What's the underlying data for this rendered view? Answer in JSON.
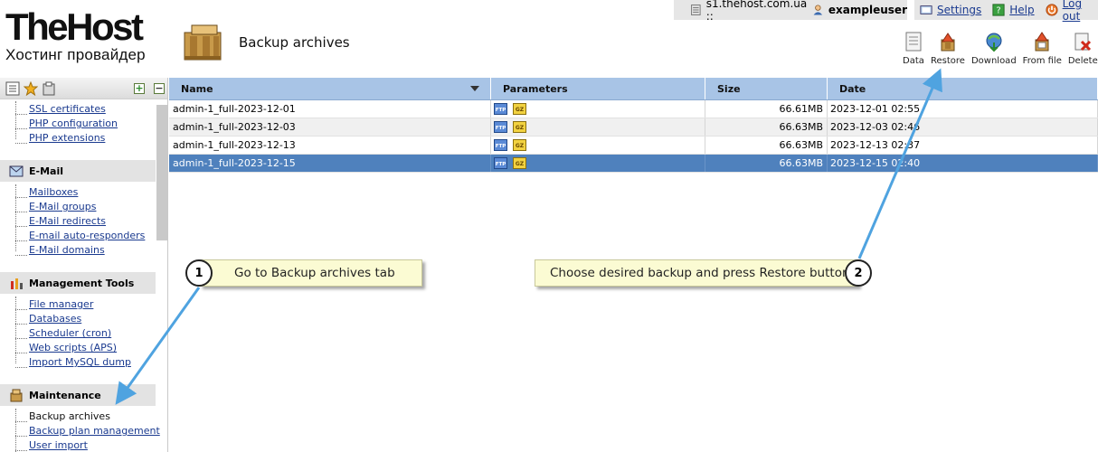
{
  "brand": {
    "name": "TheHost",
    "tagline": "Хостинг провайдер"
  },
  "page": {
    "title": "Backup archives"
  },
  "topbar": {
    "server": "s1.thehost.com.ua ::",
    "username": "exampleuser",
    "settings": "Settings",
    "help": "Help",
    "logout": "Log out"
  },
  "toolbar": [
    "Data",
    "Restore",
    "Download",
    "From file",
    "Delete"
  ],
  "sidebar": {
    "top_links": [
      "SSL certificates",
      "PHP configuration",
      "PHP extensions"
    ],
    "email": {
      "title": "E-Mail",
      "links": [
        "Mailboxes",
        "E-Mail groups",
        "E-Mail redirects",
        "E-mail auto-responders",
        "E-Mail domains"
      ]
    },
    "management": {
      "title": "Management Tools",
      "links": [
        "File manager",
        "Databases",
        "Scheduler (cron)",
        "Web scripts (APS)",
        "Import MySQL dump"
      ]
    },
    "maintenance": {
      "title": "Maintenance",
      "links": [
        "Backup archives",
        "Backup plan management",
        "User import"
      ]
    }
  },
  "table": {
    "columns": [
      "Name",
      "Parameters",
      "Size",
      "Date"
    ],
    "rows": [
      {
        "name": "admin-1_full-2023-12-01",
        "size": "66.61MB",
        "date": "2023-12-01 02:55"
      },
      {
        "name": "admin-1_full-2023-12-03",
        "size": "66.63MB",
        "date": "2023-12-03 02:46"
      },
      {
        "name": "admin-1_full-2023-12-13",
        "size": "66.63MB",
        "date": "2023-12-13 02:37"
      },
      {
        "name": "admin-1_full-2023-12-15",
        "size": "66.63MB",
        "date": "2023-12-15 02:40"
      }
    ],
    "param_icons": [
      "ftp-icon",
      "gz-icon"
    ],
    "selected_row": 3
  },
  "callouts": [
    {
      "number": "1",
      "text": "Go to Backup archives tab"
    },
    {
      "number": "2",
      "text": "Choose desired backup and press Restore button"
    }
  ],
  "colors": {
    "header_blue": "#a8c4e6",
    "selection": "#4f81bd",
    "callout_bg": "#fbfbd3",
    "arrow": "#4fa3e0",
    "link": "#1a3a8f"
  }
}
